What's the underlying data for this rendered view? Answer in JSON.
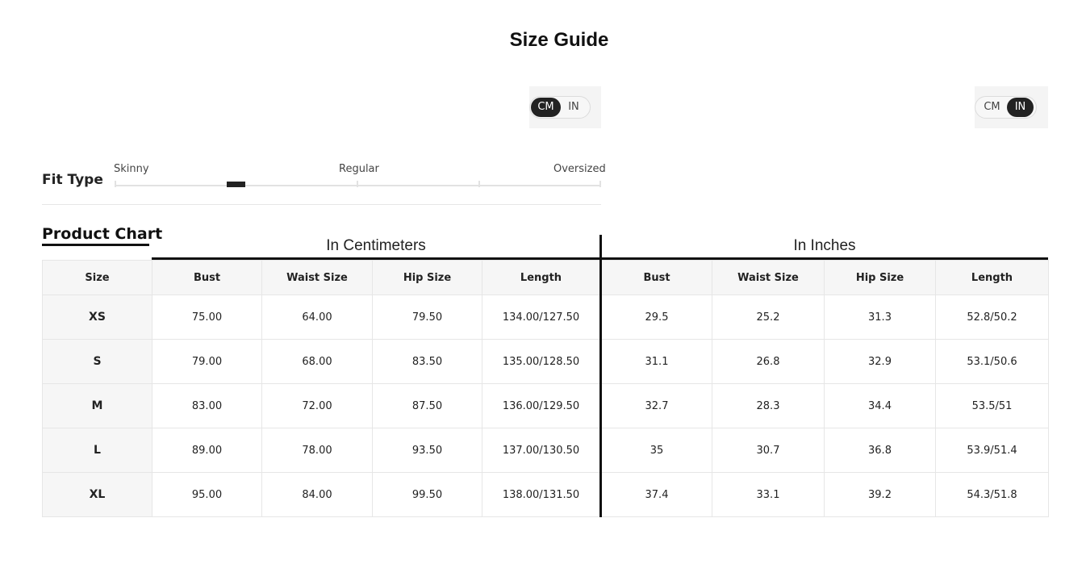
{
  "title": "Size Guide",
  "unit_toggle_left": {
    "options": [
      "CM",
      "IN"
    ],
    "selected": "CM"
  },
  "unit_toggle_right": {
    "options": [
      "CM",
      "IN"
    ],
    "selected": "IN"
  },
  "fit_type": {
    "label": "Fit Type",
    "scale": [
      "Skinny",
      "Regular",
      "Oversized"
    ],
    "position": 0.25
  },
  "chart": {
    "heading": "Product Chart",
    "cm_label": "In Centimeters",
    "in_label": "In Inches",
    "columns": [
      "Size",
      "Bust",
      "Waist Size",
      "Hip Size",
      "Length",
      "Bust",
      "Waist Size",
      "Hip Size",
      "Length"
    ],
    "rows": [
      [
        "XS",
        "75.00",
        "64.00",
        "79.50",
        "134.00/127.50",
        "29.5",
        "25.2",
        "31.3",
        "52.8/50.2"
      ],
      [
        "S",
        "79.00",
        "68.00",
        "83.50",
        "135.00/128.50",
        "31.1",
        "26.8",
        "32.9",
        "53.1/50.6"
      ],
      [
        "M",
        "83.00",
        "72.00",
        "87.50",
        "136.00/129.50",
        "32.7",
        "28.3",
        "34.4",
        "53.5/51"
      ],
      [
        "L",
        "89.00",
        "78.00",
        "93.50",
        "137.00/130.50",
        "35",
        "30.7",
        "36.8",
        "53.9/51.4"
      ],
      [
        "XL",
        "95.00",
        "84.00",
        "99.50",
        "138.00/131.50",
        "37.4",
        "33.1",
        "39.2",
        "54.3/51.8"
      ]
    ]
  }
}
